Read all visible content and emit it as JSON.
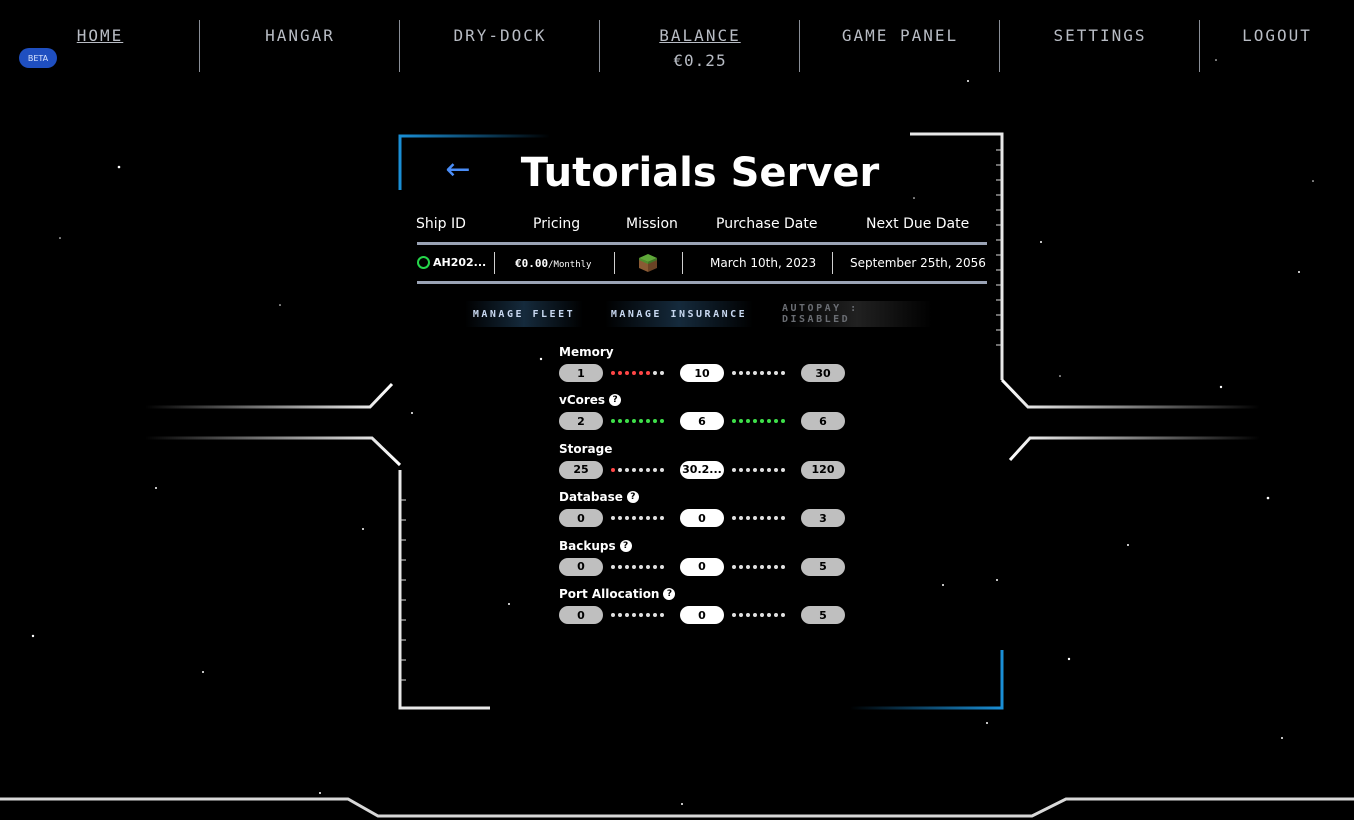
{
  "nav": {
    "items": [
      {
        "label": "HOME"
      },
      {
        "label": "HANGAR"
      },
      {
        "label": "DRY-DOCK"
      },
      {
        "label": "BALANCE",
        "value": "€0.25"
      },
      {
        "label": "GAME PANEL"
      },
      {
        "label": "SETTINGS"
      },
      {
        "label": "LOGOUT"
      }
    ],
    "beta": "BETA"
  },
  "server": {
    "title": "Tutorials Server",
    "headers": {
      "ship_id": "Ship ID",
      "pricing": "Pricing",
      "mission": "Mission",
      "purchase_date": "Purchase Date",
      "next_due_date": "Next Due Date"
    },
    "ship_id": "AH202...",
    "price": "€0.00",
    "price_period": "/Monthly",
    "purchase_date": "March 10th, 2023",
    "next_due_date": "September 25th, 2056"
  },
  "actions": {
    "manage_fleet": "MANAGE FLEET",
    "manage_insurance": "MANAGE INSURANCE",
    "autopay": "AUTOPAY : DISABLED"
  },
  "resources": [
    {
      "label": "Memory",
      "min": "1",
      "current": "10",
      "max": "30",
      "help": false
    },
    {
      "label": "vCores",
      "min": "2",
      "current": "6",
      "max": "6",
      "help": true
    },
    {
      "label": "Storage",
      "min": "25",
      "current": "30.2...",
      "max": "120",
      "help": false
    },
    {
      "label": "Database",
      "min": "0",
      "current": "0",
      "max": "3",
      "help": true
    },
    {
      "label": "Backups",
      "min": "0",
      "current": "0",
      "max": "5",
      "help": true
    },
    {
      "label": "Port Allocation",
      "min": "0",
      "current": "0",
      "max": "5",
      "help": true
    }
  ],
  "help_glyph": "?",
  "colors": {
    "accent_blue": "#4a8df7",
    "frame_glow": "#1a8fd6",
    "status_green": "#25d54a",
    "bar_red": "#ff4646",
    "bar_green": "#3ee04a"
  }
}
